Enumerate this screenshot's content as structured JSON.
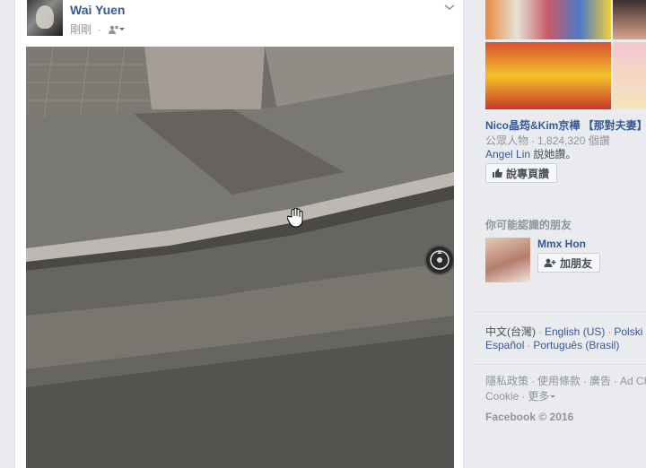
{
  "post": {
    "author": "Wai Yuen",
    "time": "剛剛",
    "audience_icon": "friends-icon",
    "menu_icon": "chevron-down-icon"
  },
  "photo": {
    "control_icon": "360-view-icon",
    "cursor_icon": "hand-cursor-icon"
  },
  "sidebar": {
    "page_name": "Nico晶筠&Kim京樺 【那對夫妻】",
    "page_category": "公眾人物",
    "page_likes": "1,824,320 個讚",
    "friend_name": "Angel Lin",
    "friend_action": " 說她讚。",
    "like_button": "說專頁讚",
    "suggested_title": "你可能認識的朋友",
    "suggested_name": "Mmx Hon",
    "add_friend_button": "加朋友"
  },
  "languages": [
    "中文(台灣)",
    "English (US)",
    "Polski",
    "Español",
    "Português (Brasil)"
  ],
  "footer": {
    "links": [
      "隱私政策",
      "使用條款",
      "廣告",
      "Ad Choices"
    ],
    "cookies": "Cookie",
    "more": "更多",
    "copyright": "Facebook © 2016"
  }
}
